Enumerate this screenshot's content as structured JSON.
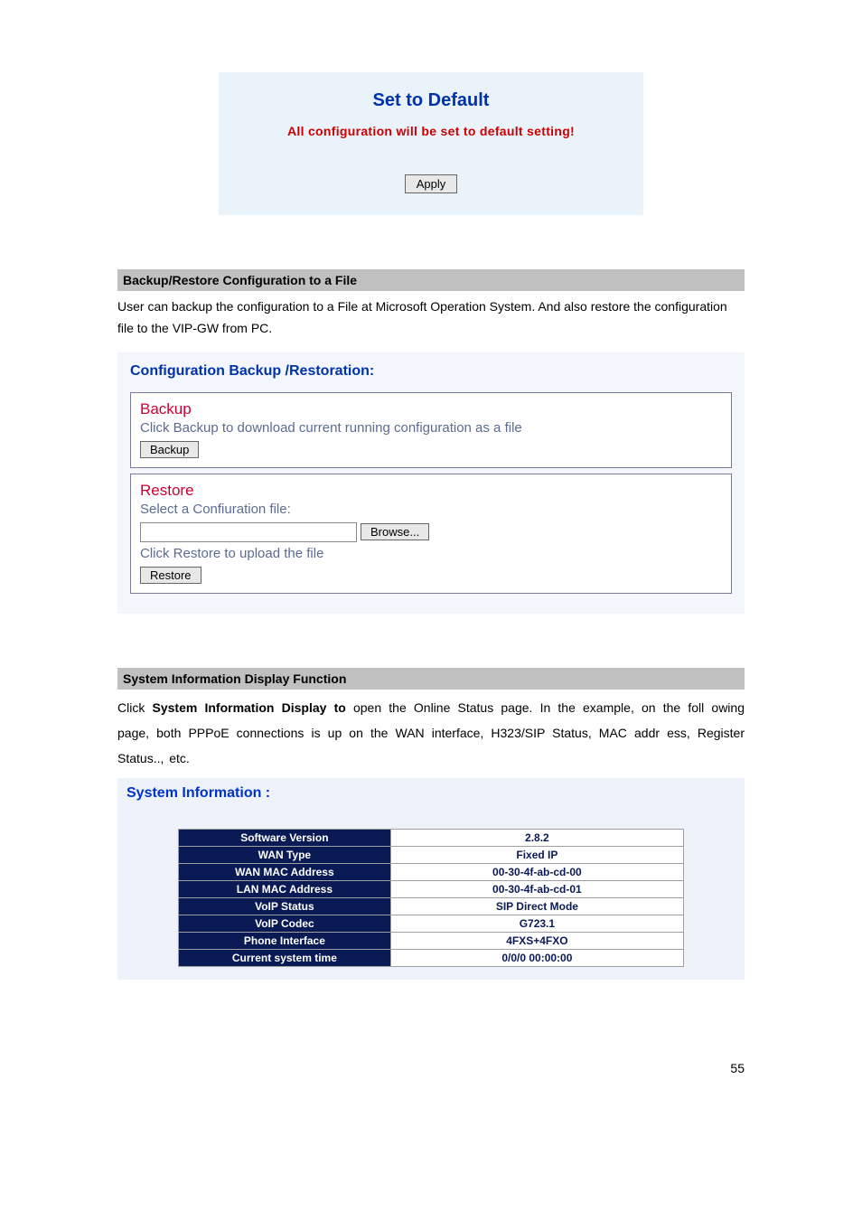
{
  "set_default": {
    "title": "Set to Default",
    "warning": "All   configuration will be set to default setting!",
    "apply": "Apply"
  },
  "backup_restore": {
    "heading": "Backup/Restore Configuration to a File",
    "para": "User can backup the configuration to a File at Microsoft Operation System. And also restore the configuration file to the VIP-GW from PC.",
    "panel_title": "Configuration Backup /Restoration:",
    "backup": {
      "title": "Backup",
      "text": "Click Backup to download current running configuration as a file",
      "button": "Backup"
    },
    "restore": {
      "title": "Restore",
      "text": "Select a Confiuration file:",
      "browse": "Browse...",
      "upload_text": "Click Restore to upload the file",
      "button": "Restore"
    }
  },
  "sysinfo": {
    "heading": "System Information Display Function",
    "para_prefix": "Click ",
    "para_bold": "System Information Display to",
    "para_suffix": " open the Online Status page. In the example, on the foll owing page, both PPPoE connections is up on the WAN interface, H323/SIP Status, MAC addr ess, Register Status.., etc.",
    "panel_title": "System Information :",
    "rows": [
      {
        "k": "Software Version",
        "v": "2.8.2"
      },
      {
        "k": "WAN Type",
        "v": "Fixed IP"
      },
      {
        "k": "WAN MAC Address",
        "v": "00-30-4f-ab-cd-00"
      },
      {
        "k": "LAN MAC Address",
        "v": "00-30-4f-ab-cd-01"
      },
      {
        "k": "VoIP Status",
        "v": "SIP Direct Mode"
      },
      {
        "k": "VoIP Codec",
        "v": "G723.1"
      },
      {
        "k": "Phone Interface",
        "v": "4FXS+4FXO"
      },
      {
        "k": "Current system time",
        "v": "0/0/0 00:00:00"
      }
    ]
  },
  "page_number": "55"
}
